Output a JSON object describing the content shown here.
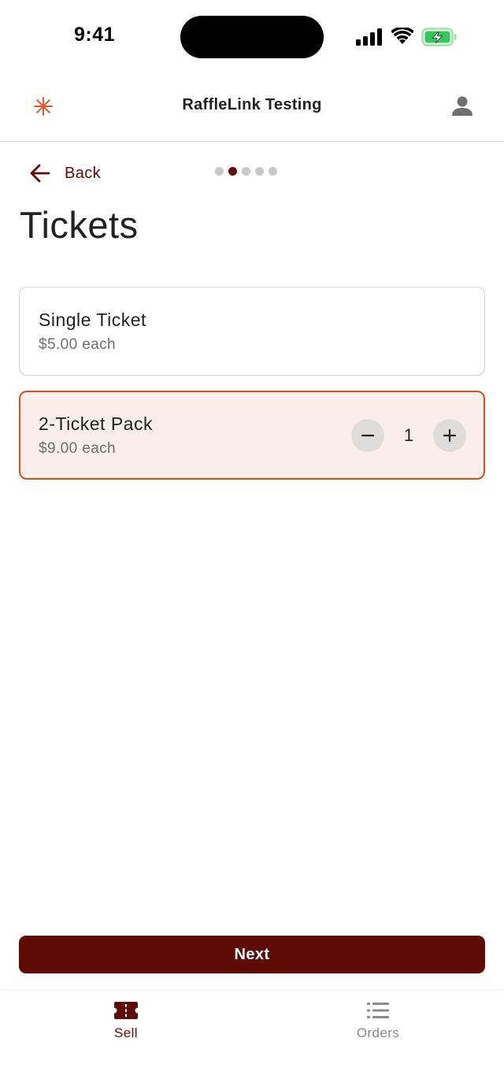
{
  "status_bar": {
    "time": "9:41"
  },
  "header": {
    "title": "RaffleLink Testing",
    "logo_icon": "asterisk-icon",
    "account_icon": "person-icon"
  },
  "navigation": {
    "back_label": "Back",
    "steps_total": 5,
    "current_step": 2
  },
  "page": {
    "title": "Tickets"
  },
  "tickets": [
    {
      "name": "Single Ticket",
      "price": "$5.00 each",
      "selected": false
    },
    {
      "name": "2-Ticket Pack",
      "price": "$9.00 each",
      "selected": true,
      "quantity": "1"
    }
  ],
  "actions": {
    "next_label": "Next"
  },
  "bottom_nav": {
    "tabs": [
      {
        "label": "Sell",
        "icon": "ticket-icon",
        "active": true
      },
      {
        "label": "Orders",
        "icon": "list-icon",
        "active": false
      }
    ]
  },
  "colors": {
    "primary": "#5e0a05",
    "accent": "#d4511f",
    "selected_bg": "#faeeea",
    "logo": "#e8562a"
  }
}
